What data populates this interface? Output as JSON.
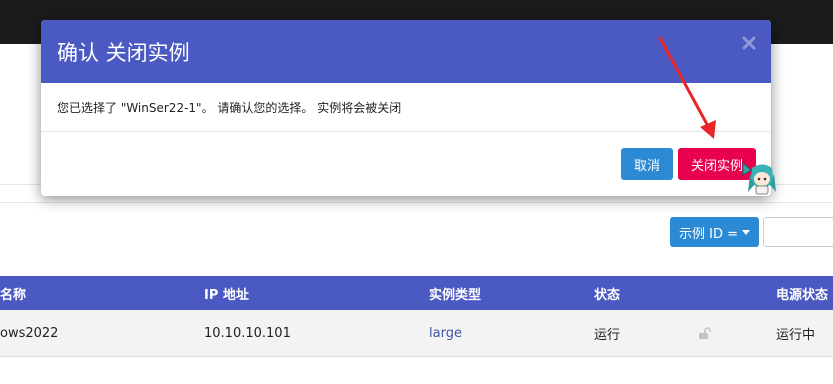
{
  "dialog": {
    "title": "确认 关闭实例",
    "message": "您已选择了 \"WinSer22-1\"。 请确认您的选择。 实例将会被关闭",
    "cancel_label": "取消",
    "confirm_label": "关闭实例"
  },
  "filter": {
    "button_label": "示例 ID =",
    "input_value": ""
  },
  "table": {
    "headers": [
      "名称",
      "IP 地址",
      "实例类型",
      "状态",
      "电源状态"
    ],
    "rows": [
      {
        "name": "ows2022",
        "ip": "10.10.10.101",
        "type": "large",
        "status": "运行",
        "power_state": "运行中"
      }
    ]
  },
  "colors": {
    "header_blue": "#4b59c3",
    "primary_blue": "#2c8ad4",
    "danger_red": "#e8014d",
    "annotation_arrow": "#e8262a"
  }
}
